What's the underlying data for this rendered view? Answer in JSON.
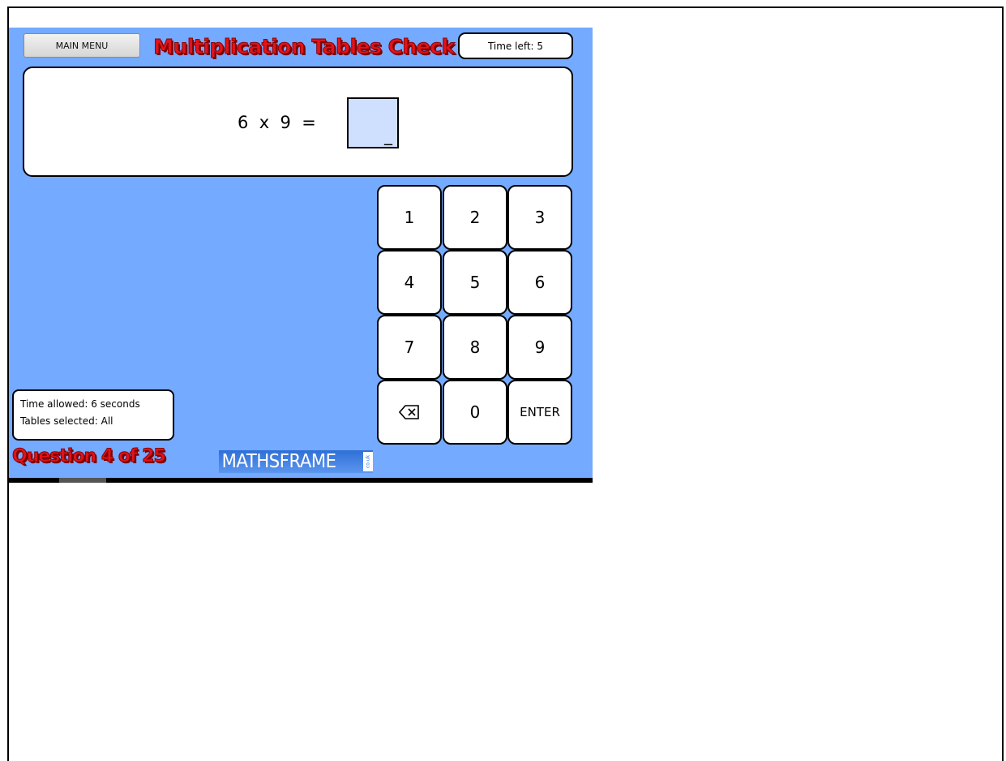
{
  "header": {
    "main_menu_label": "MAIN MENU",
    "title": "Multiplication Tables Check",
    "timer_text": "Time left: 5"
  },
  "question": {
    "equation": "6  x  9  =",
    "answer_value": "_"
  },
  "keypad": {
    "keys": [
      "1",
      "2",
      "3",
      "4",
      "5",
      "6",
      "7",
      "8",
      "9",
      "backspace",
      "0",
      "ENTER"
    ],
    "labels": {
      "k1": "1",
      "k2": "2",
      "k3": "3",
      "k4": "4",
      "k5": "5",
      "k6": "6",
      "k7": "7",
      "k8": "8",
      "k9": "9",
      "k0": "0",
      "enter": "ENTER"
    },
    "backspace_icon": "backspace-icon"
  },
  "info": {
    "time_allowed": "Time allowed: 6 seconds",
    "tables_selected": "Tables selected: All"
  },
  "progress": {
    "question_text": "Question 4 of 25"
  },
  "branding": {
    "logo_text": "MATHSFRAME",
    "logo_tld": "co.uk"
  },
  "colors": {
    "background": "#74aaff",
    "title_red": "#e0141b",
    "answer_box": "#cfe0ff"
  }
}
